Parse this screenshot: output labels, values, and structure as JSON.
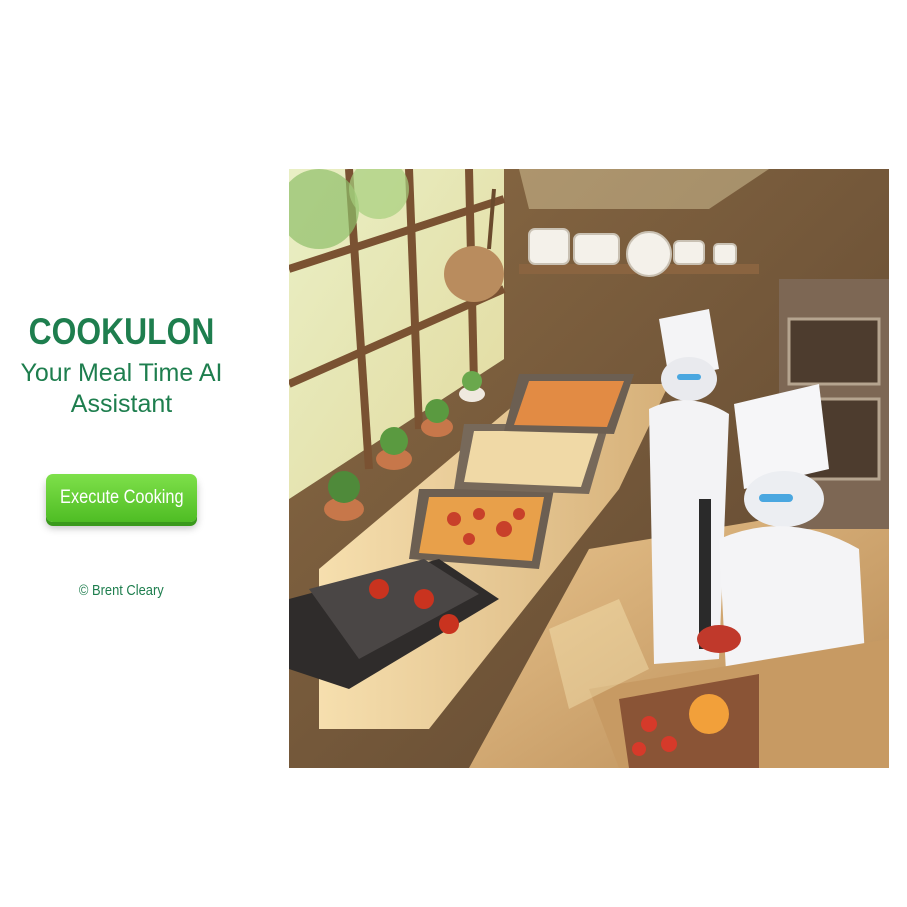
{
  "app": {
    "title": "COOKULON",
    "subtitle": "Your Meal Time AI Assistant"
  },
  "actions": {
    "execute_label": "Execute Cooking"
  },
  "footer": {
    "copyright": "© Brent Cleary"
  },
  "colors": {
    "brand_green": "#1e7e4e",
    "button_green": "#5cc92e",
    "background": "#ffffff"
  },
  "hero": {
    "alt": "Two robot chefs cooking in a sunlit kitchen"
  }
}
